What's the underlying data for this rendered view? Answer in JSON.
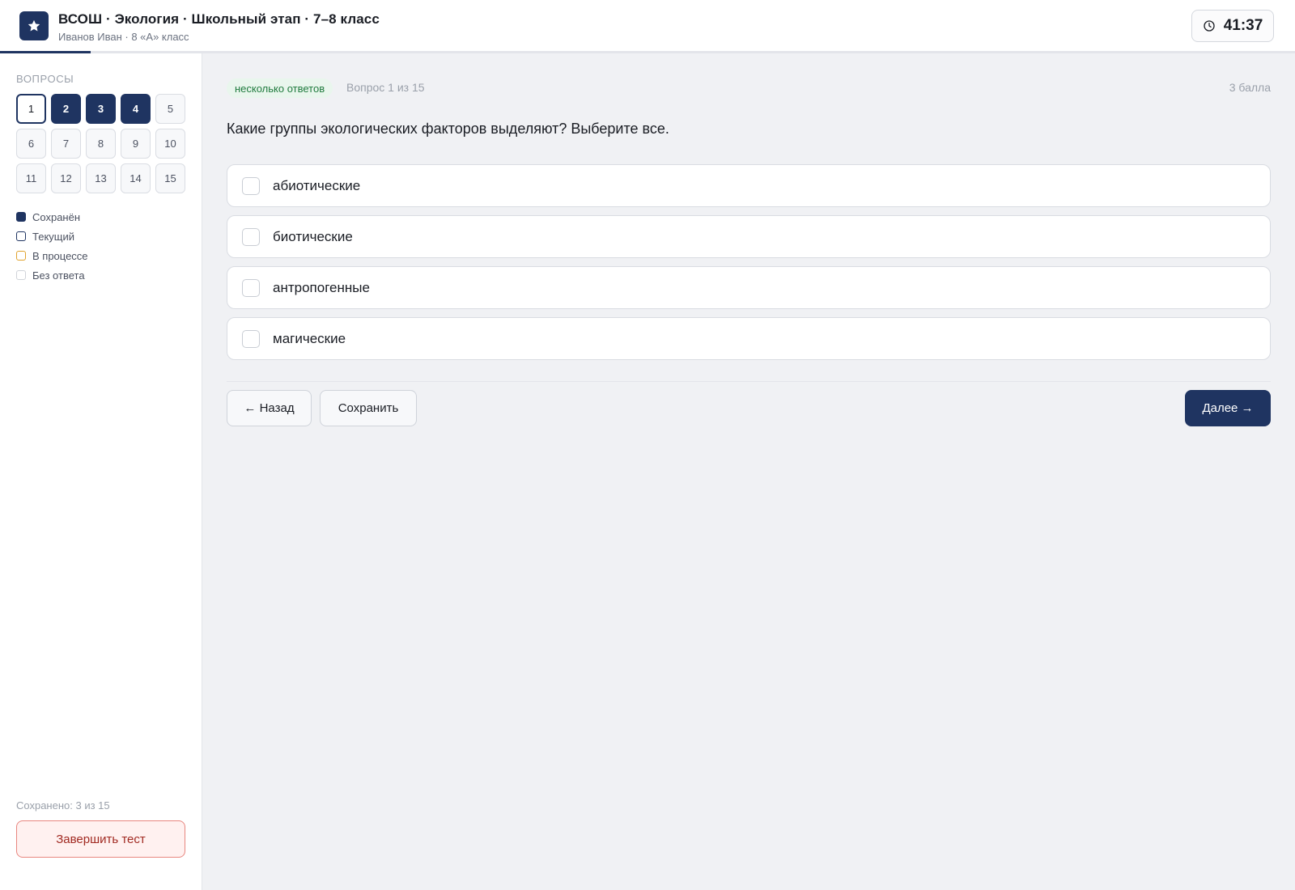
{
  "header": {
    "title": "ВСОШ · Экология · Школьный этап · 7–8 класс",
    "subtitle": "Иванов Иван · 8 «А» класс",
    "timer": "41:37",
    "icons": {
      "logo": "star-icon",
      "timer": "clock-icon"
    }
  },
  "progress": {
    "fraction": 0.07
  },
  "sidebar": {
    "heading": "ВОПРОСЫ",
    "questions": [
      {
        "label": "1",
        "status": "current"
      },
      {
        "label": "2",
        "status": "saved"
      },
      {
        "label": "3",
        "status": "saved"
      },
      {
        "label": "4",
        "status": "saved"
      },
      {
        "label": "5",
        "status": "empty"
      },
      {
        "label": "6",
        "status": "empty"
      },
      {
        "label": "7",
        "status": "empty"
      },
      {
        "label": "8",
        "status": "empty"
      },
      {
        "label": "9",
        "status": "empty"
      },
      {
        "label": "10",
        "status": "empty"
      },
      {
        "label": "11",
        "status": "empty"
      },
      {
        "label": "12",
        "status": "empty"
      },
      {
        "label": "13",
        "status": "empty"
      },
      {
        "label": "14",
        "status": "empty"
      },
      {
        "label": "15",
        "status": "empty"
      }
    ],
    "legend": [
      {
        "status": "saved",
        "label": "Сохранён"
      },
      {
        "status": "current",
        "label": "Текущий"
      },
      {
        "status": "progress",
        "label": "В процессе"
      },
      {
        "status": "empty",
        "label": "Без ответа"
      }
    ],
    "saved_count": "Сохранено: 3 из 15",
    "finish_label": "Завершить тест"
  },
  "main": {
    "tag": "несколько ответов",
    "question_number": "Вопрос 1 из 15",
    "points": "3 балла",
    "question": "Какие группы экологических факторов выделяют? Выберите все.",
    "options": [
      {
        "label": "абиотические",
        "checked": false
      },
      {
        "label": "биотические",
        "checked": false
      },
      {
        "label": "антропогенные",
        "checked": false
      },
      {
        "label": "магические",
        "checked": false
      }
    ],
    "back_label": "← Назад",
    "save_label": "Сохранить",
    "next_label": "Далее →"
  },
  "colors": {
    "primary": "#1f3461",
    "tag_bg": "#e9f6ed",
    "tag_text": "#1f7a3d",
    "in_progress": "#e0a32e",
    "danger_bg": "#fff1f0",
    "danger_border": "#e8867f",
    "danger_text": "#a12a22"
  }
}
